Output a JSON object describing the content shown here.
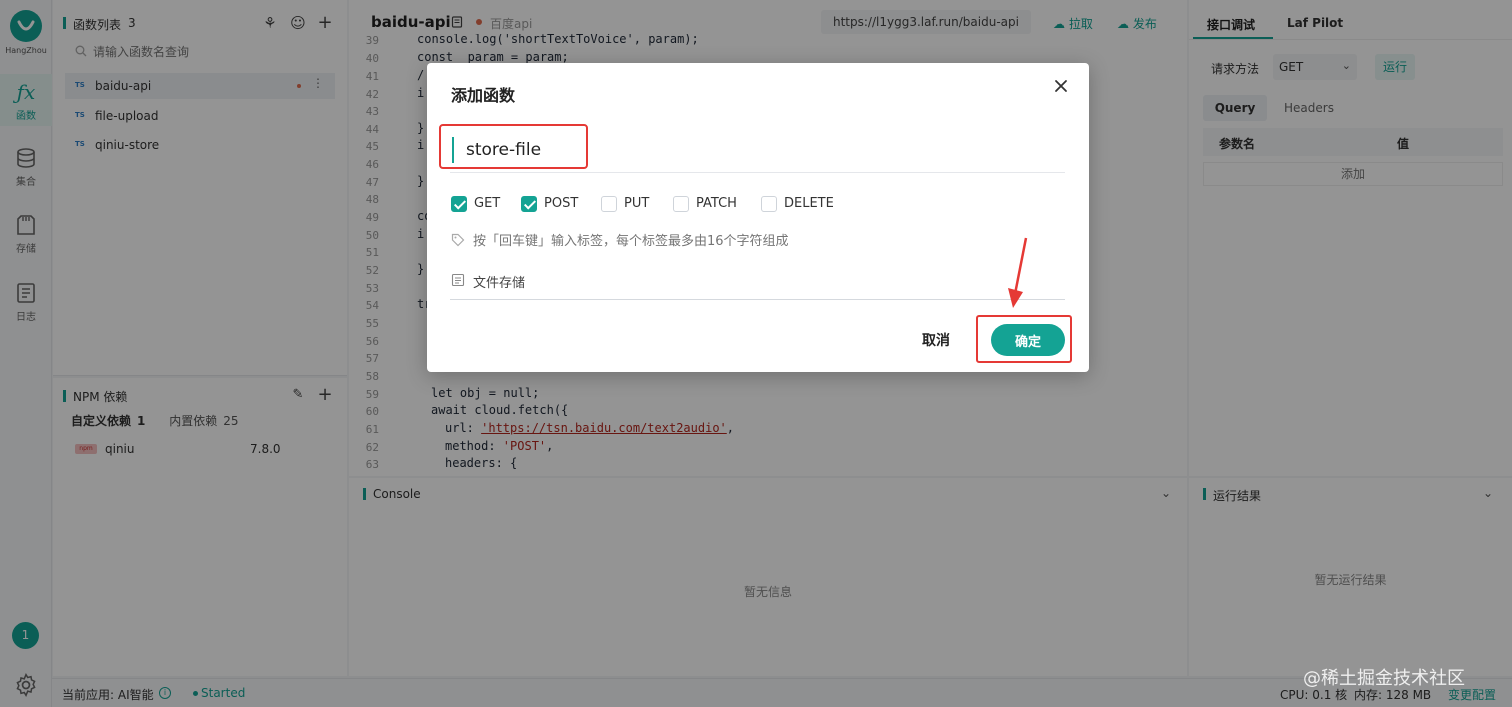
{
  "rail": {
    "region": "HangZhou",
    "nav": [
      {
        "icon": "function-icon",
        "label": "函数"
      },
      {
        "icon": "database-icon",
        "label": "集合"
      },
      {
        "icon": "storage-icon",
        "label": "存储"
      },
      {
        "icon": "log-icon",
        "label": "日志"
      }
    ],
    "badge": "1"
  },
  "functions": {
    "title": "函数列表",
    "count": "3",
    "search_placeholder": "请输入函数名查询",
    "lang_tag": "TS",
    "items": [
      {
        "name": "baidu-api"
      },
      {
        "name": "file-upload"
      },
      {
        "name": "qiniu-store"
      }
    ]
  },
  "npm": {
    "title": "NPM 依赖",
    "custom_label": "自定义依赖",
    "custom_count": "1",
    "builtin_label": "内置依赖",
    "builtin_count": "25",
    "icon_text": "npm",
    "packages": [
      {
        "name": "qiniu",
        "version": "7.8.0"
      }
    ]
  },
  "editor": {
    "file_name": "baidu-api",
    "description": "百度api",
    "url": "https://l1ygg3.laf.run/baidu-api",
    "pull_label": "拉取",
    "publish_label": "发布",
    "line_numbers": [
      "39",
      "40",
      "41",
      "42",
      "43",
      "44",
      "45",
      "46",
      "47",
      "48",
      "49",
      "50",
      "51",
      "52",
      "53",
      "54",
      "55",
      "56",
      "57",
      "58",
      "59",
      "60",
      "61",
      "62",
      "63"
    ],
    "code": {
      "l39": "console.log('shortTextToVoice', param);",
      "l40": "const  param = param;",
      "l41": "/",
      "l42": "i",
      "l44": "}",
      "l45": "i",
      "l47": "}",
      "l49": "co",
      "l50": "i",
      "l52": "}",
      "l54": "tr",
      "l59": "let obj = null;",
      "l60": "await cloud.fetch({",
      "l61_key": "url: ",
      "l61_val": "'https://tsn.baidu.com/text2audio'",
      "l61_end": ",",
      "l62_key": "method: ",
      "l62_val": "'POST'",
      "l62_end": ",",
      "l63": "headers: {"
    }
  },
  "console": {
    "title": "Console",
    "empty": "暂无信息"
  },
  "debug": {
    "tab_api": "接口调试",
    "tab_pilot": "Laf Pilot",
    "method_label": "请求方法",
    "method_value": "GET",
    "run_label": "运行",
    "tab_query": "Query",
    "tab_headers": "Headers",
    "col_param": "参数名",
    "col_value": "值",
    "add_label": "添加"
  },
  "result": {
    "title": "运行结果",
    "empty": "暂无运行结果"
  },
  "status": {
    "current_app": "当前应用: AI智能",
    "state": "Started",
    "cpu": "CPU: 0.1 核",
    "memory": "内存: 128 MB",
    "change_config": "变更配置"
  },
  "modal": {
    "title": "添加函数",
    "name_value": "store-file",
    "methods": [
      {
        "label": "GET",
        "checked": true
      },
      {
        "label": "POST",
        "checked": true
      },
      {
        "label": "PUT",
        "checked": false
      },
      {
        "label": "PATCH",
        "checked": false
      },
      {
        "label": "DELETE",
        "checked": false
      }
    ],
    "tag_placeholder": "按「回车键」输入标签，每个标签最多由16个字符组成",
    "description_value": "文件存储",
    "cancel_label": "取消",
    "confirm_label": "确定"
  },
  "watermark": "@稀土掘金技术社区",
  "colors": {
    "accent": "#14a394",
    "highlight": "#e53935",
    "mask": "rgba(0,0,0,0.42)"
  }
}
